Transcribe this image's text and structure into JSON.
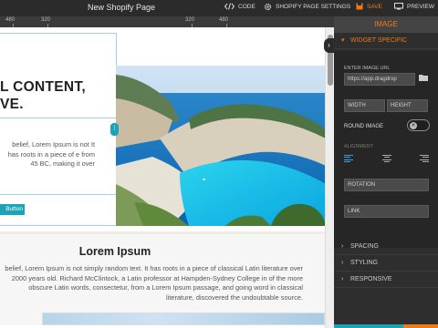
{
  "topbar": {
    "title": "New Shopify Page",
    "code_label": "CODE",
    "settings_label": "SHOPIFY PAGE SETTINGS",
    "save_label": "SAVE",
    "preview_label": "PREVIEW"
  },
  "ruler": {
    "marks": [
      "480",
      "320",
      "320",
      "480"
    ]
  },
  "hero": {
    "headline_line1": "L CONTENT,",
    "headline_line2": "VE.",
    "paragraph": "belief, Lorem Ipsum is not It has roots in a piece of e from 45 BC, making it over",
    "button_label": "Button"
  },
  "section2": {
    "heading": "Lorem Ipsum",
    "paragraph": "belief, Lorem Ipsum is not simply random text. It has roots in a piece of classical Latin literature over 2000 years old. Richard McClintock, a Latin professor at Hampden-Sydney College in of the more obscure Latin words, consectetur, from a Lorem Ipsum passage, and going word in classical literature, discovered the undoubtable source."
  },
  "panel": {
    "title": "IMAGE",
    "widget_specific": "WIDGET SPECIFIC",
    "image_url_label": "ENTER IMAGE URL",
    "image_url_value": "https://app.dragdrop",
    "width_label": "WIDTH",
    "height_label": "HEIGHT",
    "round_image_label": "ROUND IMAGE",
    "alignment_label": "ALIGNMENT",
    "rotation_label": "ROTATION",
    "link_label": "LINK",
    "spacing_label": "SPACING",
    "styling_label": "STYLING",
    "responsive_label": "RESPONSIVE"
  },
  "colors": {
    "accent": "#f07a1a",
    "teal": "#1da3b8",
    "panel_bg": "#2e2e2e"
  }
}
